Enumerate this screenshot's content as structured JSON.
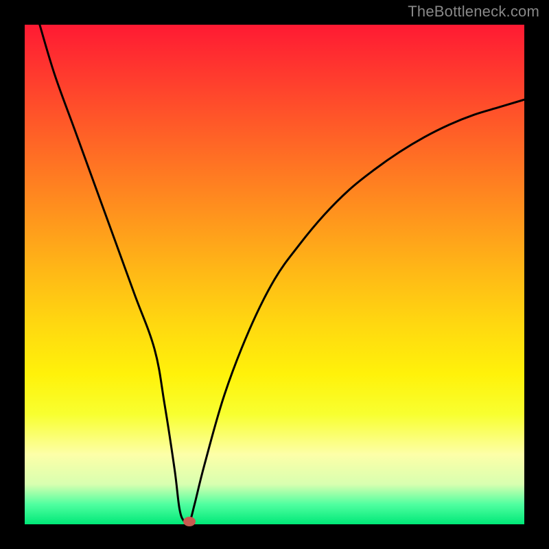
{
  "watermark": "TheBottleneck.com",
  "chart_data": {
    "type": "line",
    "title": "",
    "xlabel": "",
    "ylabel": "",
    "xlim": [
      0,
      100
    ],
    "ylim": [
      0,
      100
    ],
    "series": [
      {
        "name": "curve",
        "x": [
          3,
          6,
          10,
          14,
          18,
          22,
          26,
          28,
          30,
          31,
          32,
          33,
          34,
          36,
          40,
          45,
          50,
          55,
          60,
          65,
          70,
          75,
          80,
          85,
          90,
          95,
          100
        ],
        "y": [
          100,
          90,
          79,
          68,
          57,
          46,
          35,
          24,
          11,
          3,
          0.5,
          0.5,
          4,
          12,
          26,
          39,
          49,
          56,
          62,
          67,
          71,
          74.5,
          77.5,
          80,
          82,
          83.5,
          85
        ]
      }
    ],
    "marker": {
      "x": 33,
      "y": 0.5
    },
    "background_gradient": {
      "top": "#ff1a33",
      "bottom": "#00e878"
    }
  }
}
